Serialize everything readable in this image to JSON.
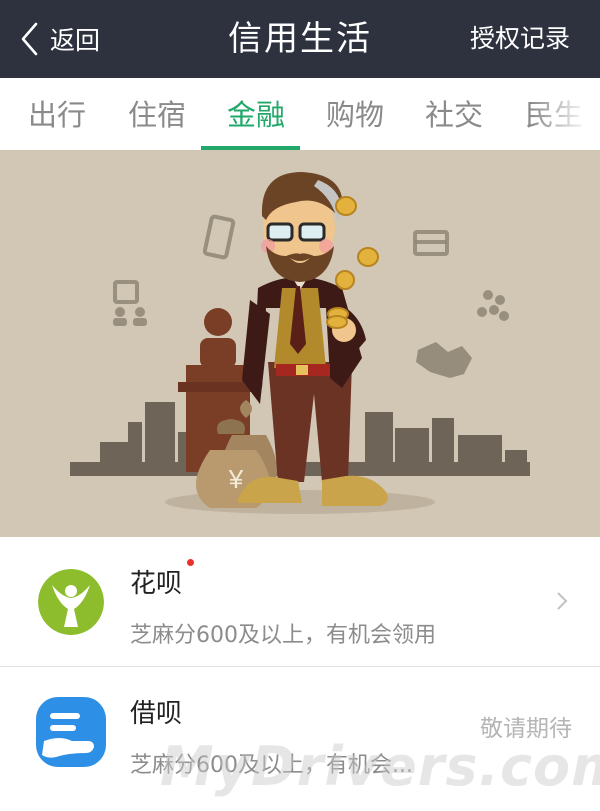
{
  "navbar": {
    "back_label": "返回",
    "title": "信用生活",
    "right_label": "授权记录"
  },
  "tabs": [
    {
      "label": "出行",
      "active": false
    },
    {
      "label": "住宿",
      "active": false
    },
    {
      "label": "金融",
      "active": true
    },
    {
      "label": "购物",
      "active": false
    },
    {
      "label": "社交",
      "active": false
    },
    {
      "label": "民生",
      "active": false
    }
  ],
  "banner": {
    "currency_symbol": "¥"
  },
  "list": {
    "items": [
      {
        "title": "花呗",
        "subtitle": "芝麻分600及以上，有机会领用",
        "has_new_dot": true,
        "logo_icon": "huabei-person-icon",
        "logo_color": "#8dbd2d"
      },
      {
        "title": "借呗",
        "subtitle": "芝麻分600及以上，有机会...",
        "status": "敬请期待",
        "logo_icon": "jiebei-hand-icon",
        "logo_color": "#2d8fe6"
      }
    ]
  },
  "watermark": "MyDrivers.com",
  "colors": {
    "navbar_bg": "#2e323f",
    "accent": "#22a86b",
    "banner_bg": "#d2c6b4"
  }
}
